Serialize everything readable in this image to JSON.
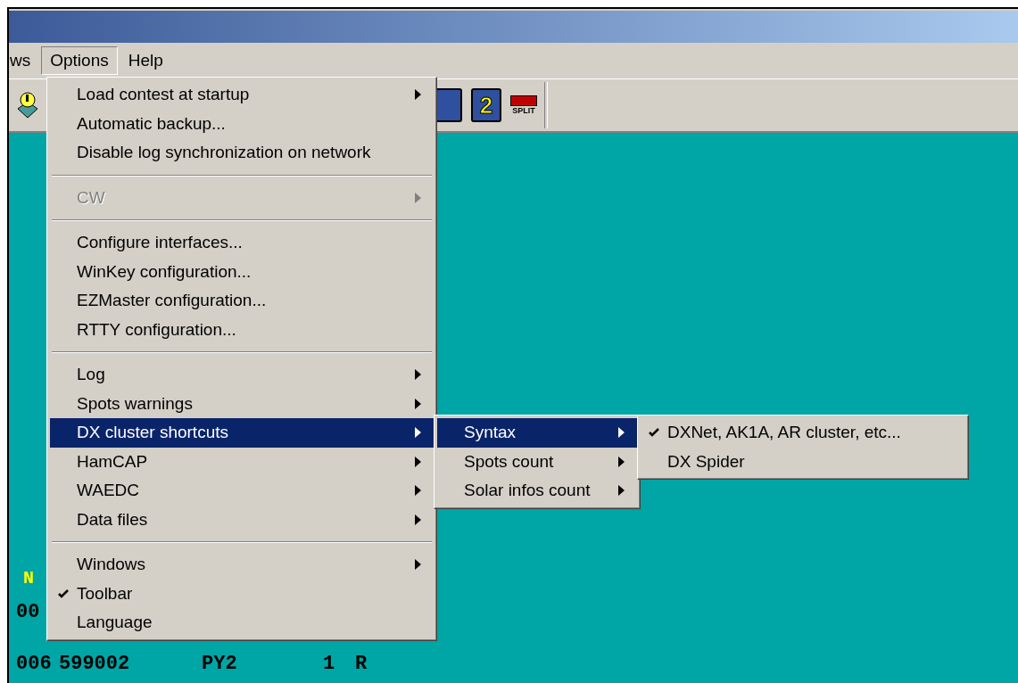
{
  "menubar": [
    {
      "label": "ws",
      "selected": false
    },
    {
      "label": "Options",
      "selected": true
    },
    {
      "label": "Help",
      "selected": false
    }
  ],
  "toolbar": {
    "right_buttons": [
      {
        "kind": "radio"
      },
      {
        "kind": "radio",
        "label": "2"
      },
      {
        "kind": "split",
        "label": "SPLIT"
      }
    ]
  },
  "options_menu": [
    {
      "kind": "item",
      "label": "Load contest at startup",
      "submenu": true,
      "disabled": false,
      "checked": false,
      "selected": false
    },
    {
      "kind": "item",
      "label": "Automatic backup...",
      "submenu": false,
      "disabled": false,
      "checked": false,
      "selected": false
    },
    {
      "kind": "item",
      "label": "Disable log synchronization on network",
      "submenu": false,
      "disabled": false,
      "checked": false,
      "selected": false
    },
    {
      "kind": "separator"
    },
    {
      "kind": "item",
      "label": "CW",
      "submenu": true,
      "disabled": true,
      "checked": false,
      "selected": false
    },
    {
      "kind": "separator"
    },
    {
      "kind": "item",
      "label": "Configure interfaces...",
      "submenu": false,
      "disabled": false,
      "checked": false,
      "selected": false
    },
    {
      "kind": "item",
      "label": "WinKey configuration...",
      "submenu": false,
      "disabled": false,
      "checked": false,
      "selected": false
    },
    {
      "kind": "item",
      "label": "EZMaster configuration...",
      "submenu": false,
      "disabled": false,
      "checked": false,
      "selected": false
    },
    {
      "kind": "item",
      "label": "RTTY configuration...",
      "submenu": false,
      "disabled": false,
      "checked": false,
      "selected": false
    },
    {
      "kind": "separator"
    },
    {
      "kind": "item",
      "label": "Log",
      "submenu": true,
      "disabled": false,
      "checked": false,
      "selected": false
    },
    {
      "kind": "item",
      "label": "Spots warnings",
      "submenu": true,
      "disabled": false,
      "checked": false,
      "selected": false
    },
    {
      "kind": "item",
      "label": "DX cluster shortcuts",
      "submenu": true,
      "disabled": false,
      "checked": false,
      "selected": true,
      "children": [
        {
          "kind": "item",
          "label": "Syntax",
          "submenu": true,
          "disabled": false,
          "checked": false,
          "selected": true,
          "children": [
            {
              "kind": "item",
              "label": "DXNet, AK1A, AR cluster, etc...",
              "submenu": false,
              "disabled": false,
              "checked": true,
              "selected": false
            },
            {
              "kind": "item",
              "label": "DX Spider",
              "submenu": false,
              "disabled": false,
              "checked": false,
              "selected": false
            }
          ]
        },
        {
          "kind": "item",
          "label": "Spots count",
          "submenu": true,
          "disabled": false,
          "checked": false,
          "selected": false
        },
        {
          "kind": "item",
          "label": "Solar infos count",
          "submenu": true,
          "disabled": false,
          "checked": false,
          "selected": false
        }
      ]
    },
    {
      "kind": "item",
      "label": "HamCAP",
      "submenu": true,
      "disabled": false,
      "checked": false,
      "selected": false
    },
    {
      "kind": "item",
      "label": "WAEDC",
      "submenu": true,
      "disabled": false,
      "checked": false,
      "selected": false
    },
    {
      "kind": "item",
      "label": "Data files",
      "submenu": true,
      "disabled": false,
      "checked": false,
      "selected": false
    },
    {
      "kind": "separator"
    },
    {
      "kind": "item",
      "label": "Windows",
      "submenu": true,
      "disabled": false,
      "checked": false,
      "selected": false
    },
    {
      "kind": "item",
      "label": "Toolbar",
      "submenu": false,
      "disabled": false,
      "checked": true,
      "selected": false
    },
    {
      "kind": "item",
      "label": "Language",
      "submenu": false,
      "disabled": false,
      "checked": false,
      "selected": false
    }
  ],
  "log": {
    "header": "N",
    "rows": [
      [
        "00"
      ],
      [
        "006",
        "599002",
        "PY2",
        "1",
        "R"
      ]
    ]
  }
}
